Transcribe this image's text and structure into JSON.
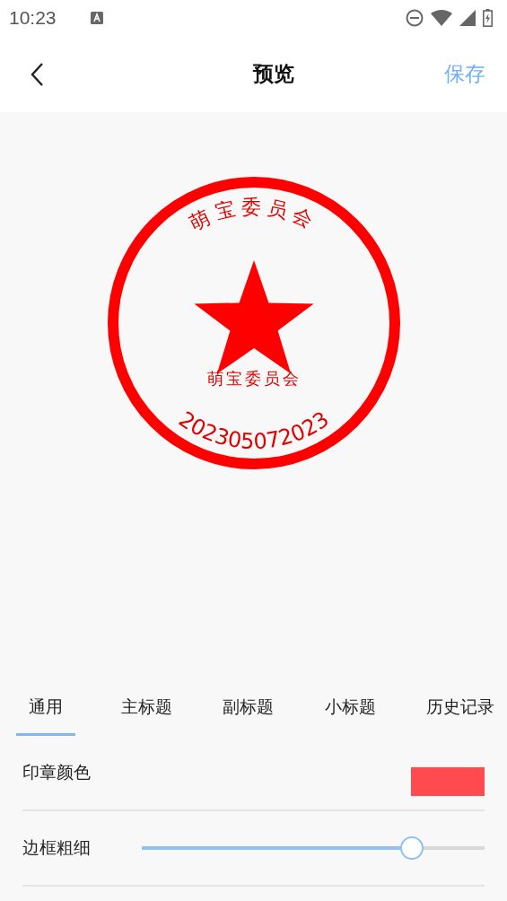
{
  "status_bar": {
    "time": "10:23"
  },
  "nav": {
    "title": "预览",
    "action": "保存"
  },
  "seal": {
    "top_text": "萌宝委员会",
    "center_text": "萌宝委员会",
    "bottom_text": "202305072023"
  },
  "tabs": [
    {
      "label": "通用",
      "selected": true
    },
    {
      "label": "主标题",
      "selected": false
    },
    {
      "label": "副标题",
      "selected": false
    },
    {
      "label": "小标题",
      "selected": false
    },
    {
      "label": "历史记录",
      "selected": false
    }
  ],
  "settings": [
    {
      "kind": "color",
      "label": "印章颜色",
      "color": "#ff4a4f"
    },
    {
      "kind": "slider",
      "label": "边框粗细",
      "level": 0.77
    }
  ]
}
